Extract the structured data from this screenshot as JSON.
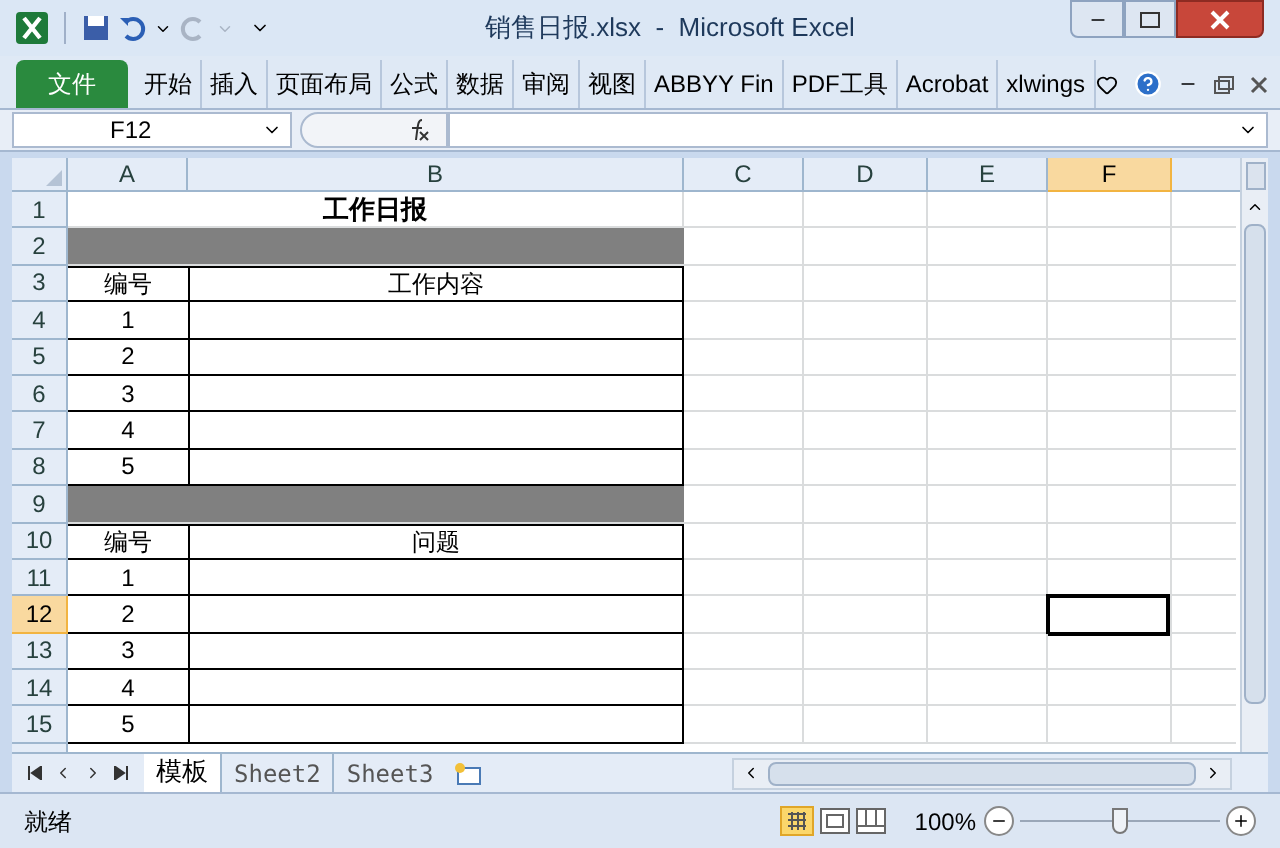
{
  "window": {
    "title": "销售日报.xlsx  -  Microsoft Excel"
  },
  "ribbon_tabs": [
    {
      "label": "文件",
      "kind": "file"
    },
    {
      "label": "开始",
      "kind": "tab"
    },
    {
      "label": "插入",
      "kind": "tab"
    },
    {
      "label": "页面布局",
      "kind": "tab"
    },
    {
      "label": "公式",
      "kind": "tab"
    },
    {
      "label": "数据",
      "kind": "tab"
    },
    {
      "label": "审阅",
      "kind": "tab"
    },
    {
      "label": "视图",
      "kind": "tab"
    },
    {
      "label": "ABBYY Fin",
      "kind": "tab"
    },
    {
      "label": "PDF工具",
      "kind": "tab"
    },
    {
      "label": "Acrobat",
      "kind": "tab"
    },
    {
      "label": "xlwings",
      "kind": "tab"
    }
  ],
  "formula_bar": {
    "name_box": "F12"
  },
  "columns": [
    {
      "label": "A",
      "selected": false
    },
    {
      "label": "B",
      "selected": false
    },
    {
      "label": "C",
      "selected": false
    },
    {
      "label": "D",
      "selected": false
    },
    {
      "label": "E",
      "selected": false
    },
    {
      "label": "F",
      "selected": true
    }
  ],
  "rows": [
    {
      "number": "1",
      "selected": false,
      "kind": "title",
      "title": "工作日报"
    },
    {
      "number": "2",
      "selected": false,
      "kind": "band"
    },
    {
      "number": "3",
      "selected": false,
      "kind": "header",
      "a": "编号",
      "b": "工作内容"
    },
    {
      "number": "4",
      "selected": false,
      "kind": "data",
      "a": "1"
    },
    {
      "number": "5",
      "selected": false,
      "kind": "data",
      "a": "2"
    },
    {
      "number": "6",
      "selected": false,
      "kind": "data",
      "a": "3"
    },
    {
      "number": "7",
      "selected": false,
      "kind": "data",
      "a": "4"
    },
    {
      "number": "8",
      "selected": false,
      "kind": "data",
      "a": "5"
    },
    {
      "number": "9",
      "selected": false,
      "kind": "band"
    },
    {
      "number": "10",
      "selected": false,
      "kind": "header",
      "a": "编号",
      "b": "问题"
    },
    {
      "number": "11",
      "selected": false,
      "kind": "data",
      "a": "1"
    },
    {
      "number": "12",
      "selected": true,
      "kind": "data",
      "a": "2"
    },
    {
      "number": "13",
      "selected": false,
      "kind": "data",
      "a": "3"
    },
    {
      "number": "14",
      "selected": false,
      "kind": "data",
      "a": "4"
    },
    {
      "number": "15",
      "selected": false,
      "kind": "data",
      "a": "5"
    }
  ],
  "sheet_tabs": [
    {
      "label": "模板",
      "selected": true
    },
    {
      "label": "Sheet2",
      "selected": false
    },
    {
      "label": "Sheet3",
      "selected": false
    }
  ],
  "status_bar": {
    "status": "就绪",
    "zoom": "100%",
    "zoom_slider": {
      "level": 0.5
    }
  }
}
